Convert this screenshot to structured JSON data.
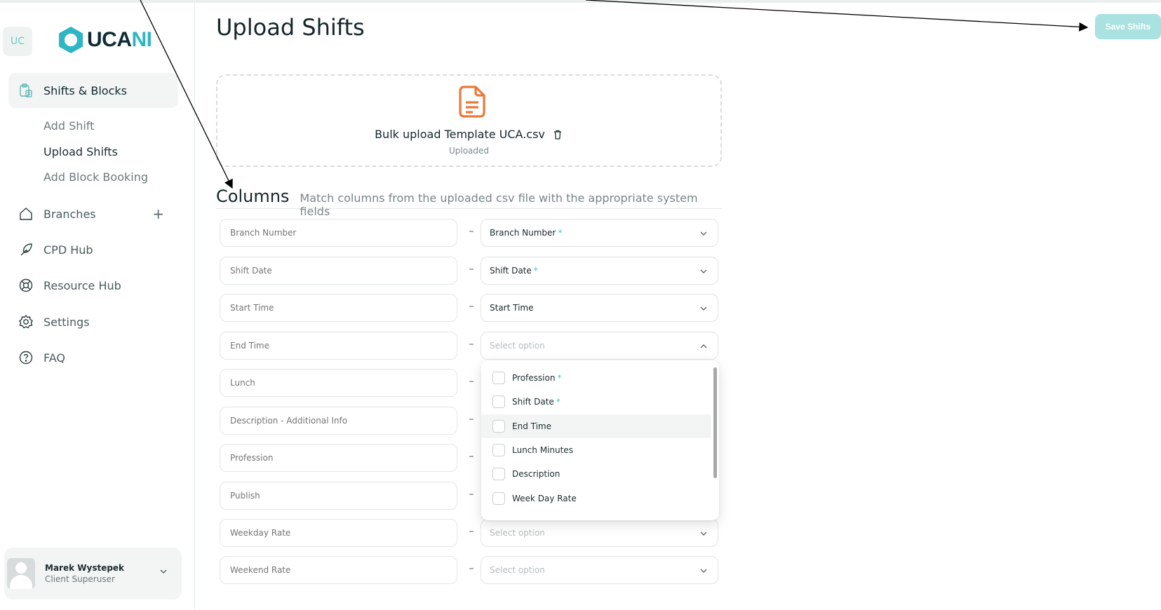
{
  "brand": {
    "badge": "UC",
    "logo_dark": "UCA",
    "logo_teal": "NI",
    "teal_color": "#2fb6c4"
  },
  "sidebar": {
    "items": [
      {
        "label": "Shifts & Blocks",
        "icon": "clipboard-icon",
        "active": true
      },
      {
        "label": "Branches",
        "icon": "home-icon",
        "has_plus": true
      },
      {
        "label": "CPD Hub",
        "icon": "feather-icon"
      },
      {
        "label": "Resource Hub",
        "icon": "lifebuoy-icon"
      },
      {
        "label": "Settings",
        "icon": "gear-icon"
      },
      {
        "label": "FAQ",
        "icon": "help-circle-icon"
      }
    ],
    "sub_items": [
      {
        "label": "Add Shift"
      },
      {
        "label": "Upload Shifts",
        "active": true
      },
      {
        "label": "Add Block Booking"
      }
    ],
    "plus_label": "+",
    "user": {
      "name": "Marek Wystepek",
      "role": "Client Superuser"
    }
  },
  "header": {
    "title": "Upload Shifts",
    "save_label": "Save Shifts"
  },
  "upload": {
    "file_name": "Bulk upload Template UCA.csv",
    "status": "Uploaded"
  },
  "columns": {
    "title": "Columns",
    "subtitle": "Match columns from the uploaded csv file with the appropriate system fields",
    "dash": "–",
    "required_mark": "*",
    "rows": [
      {
        "source": "Branch Number",
        "target": "Branch Number",
        "required": true
      },
      {
        "source": "Shift Date",
        "target": "Shift Date",
        "required": true
      },
      {
        "source": "Start Time",
        "target": "Start Time",
        "required": false
      },
      {
        "source": "End Time",
        "target": "Select option",
        "placeholder": true,
        "open": true
      },
      {
        "source": "Lunch"
      },
      {
        "source": "Description - Additional Info"
      },
      {
        "source": "Profession"
      },
      {
        "source": "Publish"
      },
      {
        "source": "Weekday Rate",
        "target": "Select option",
        "placeholder": true
      },
      {
        "source": "Weekend Rate",
        "target": "Select option",
        "placeholder": true
      }
    ]
  },
  "dropdown": {
    "options": [
      {
        "label": "Profession",
        "required": true
      },
      {
        "label": "Shift Date",
        "required": true
      },
      {
        "label": "End Time",
        "hover": true
      },
      {
        "label": "Lunch Minutes"
      },
      {
        "label": "Description"
      },
      {
        "label": "Week Day Rate"
      }
    ]
  },
  "colors": {
    "accent": "#a9e2e1",
    "file_icon": "#e8793a",
    "required": "#4cc3c0"
  }
}
